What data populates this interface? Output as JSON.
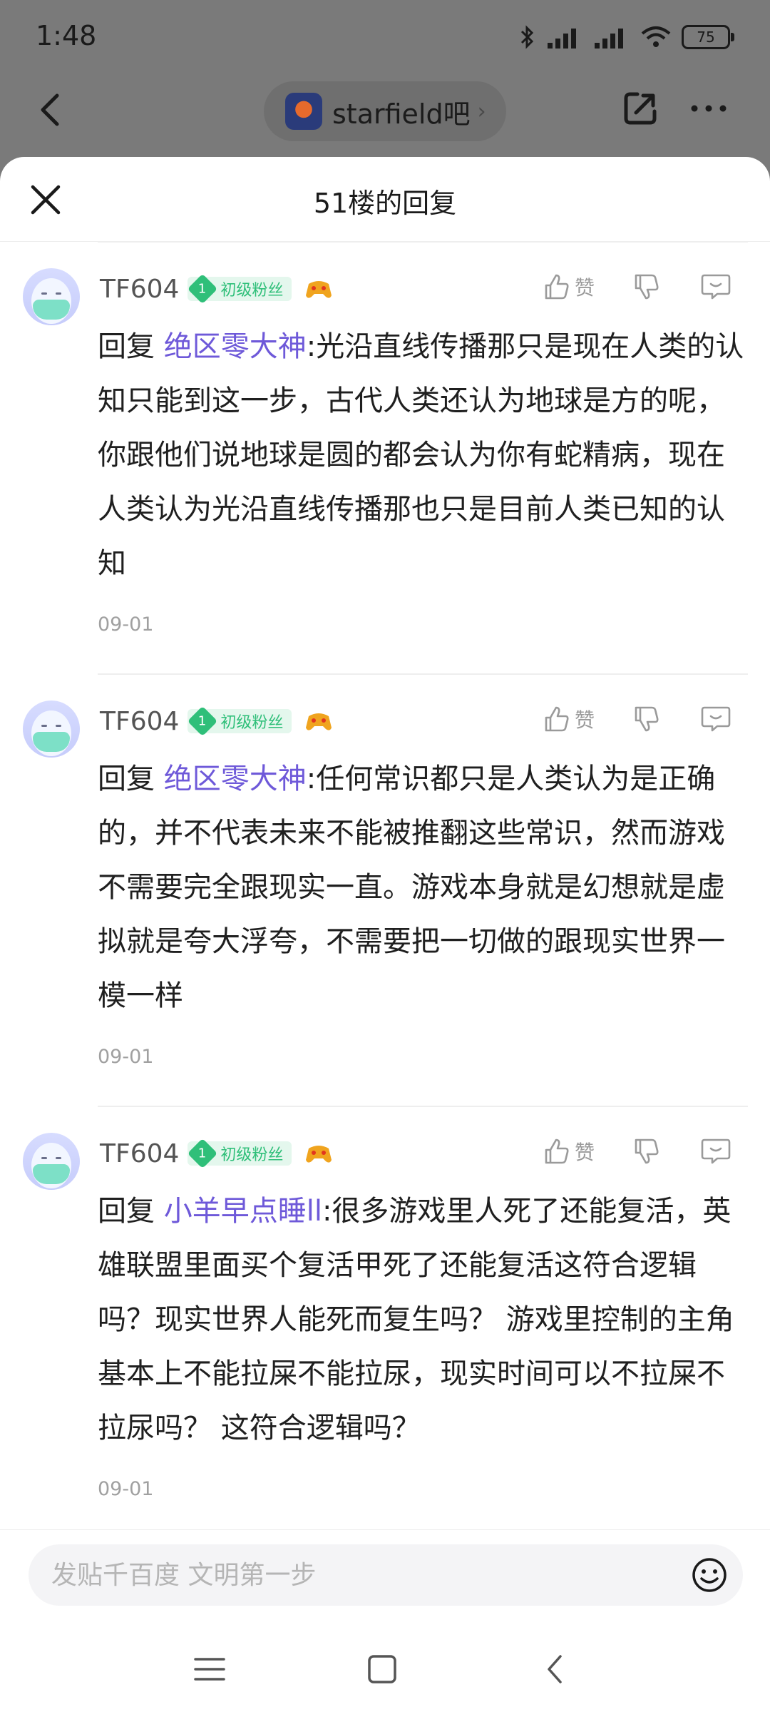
{
  "status_bar": {
    "time": "1:48",
    "battery": "75"
  },
  "header": {
    "forum_name": "starfield吧"
  },
  "sheet": {
    "title": "51楼的回复"
  },
  "replies": [
    {
      "username": "TF604",
      "fan_level": "1",
      "fan_label": "初级粉丝",
      "like_label": "赞",
      "reply_prefix": "回复 ",
      "mention": "绝区零大神",
      "text": ":光沿直线传播那只是现在人类的认知只能到这一步，古代人类还认为地球是方的呢，你跟他们说地球是圆的都会认为你有蛇精病，现在人类认为光沿直线传播那也只是目前人类已知的认知",
      "date": "09-01"
    },
    {
      "username": "TF604",
      "fan_level": "1",
      "fan_label": "初级粉丝",
      "like_label": "赞",
      "reply_prefix": "回复 ",
      "mention": "绝区零大神",
      "text": ":任何常识都只是人类认为是正确的，并不代表未来不能被推翻这些常识，然而游戏不需要完全跟现实一直。游戏本身就是幻想就是虚拟就是夸大浮夸，不需要把一切做的跟现实世界一模一样",
      "date": "09-01"
    },
    {
      "username": "TF604",
      "fan_level": "1",
      "fan_label": "初级粉丝",
      "like_label": "赞",
      "reply_prefix": "回复 ",
      "mention": "小羊早点睡ll",
      "text": ":很多游戏里人死了还能复活，英雄联盟里面买个复活甲死了还能复活这符合逻辑吗？现实世界人能死而复生吗？ 游戏里控制的主角基本上不能拉屎不能拉尿，现实时间可以不拉屎不拉尿吗？ 这符合逻辑吗？",
      "date": "09-01"
    }
  ],
  "input": {
    "placeholder": "发贴千百度 文明第一步",
    "value": ""
  },
  "icons": {
    "back": "back-arrow-icon",
    "share": "share-icon",
    "more": "more-icon",
    "close": "close-icon",
    "like": "thumbs-up-icon",
    "dislike": "thumbs-down-icon",
    "comment": "comment-icon",
    "emoji": "emoji-icon"
  },
  "colors": {
    "mention": "#6e59d9",
    "fan_badge": "#2fbf79",
    "overlay": "#7a7a7a"
  }
}
